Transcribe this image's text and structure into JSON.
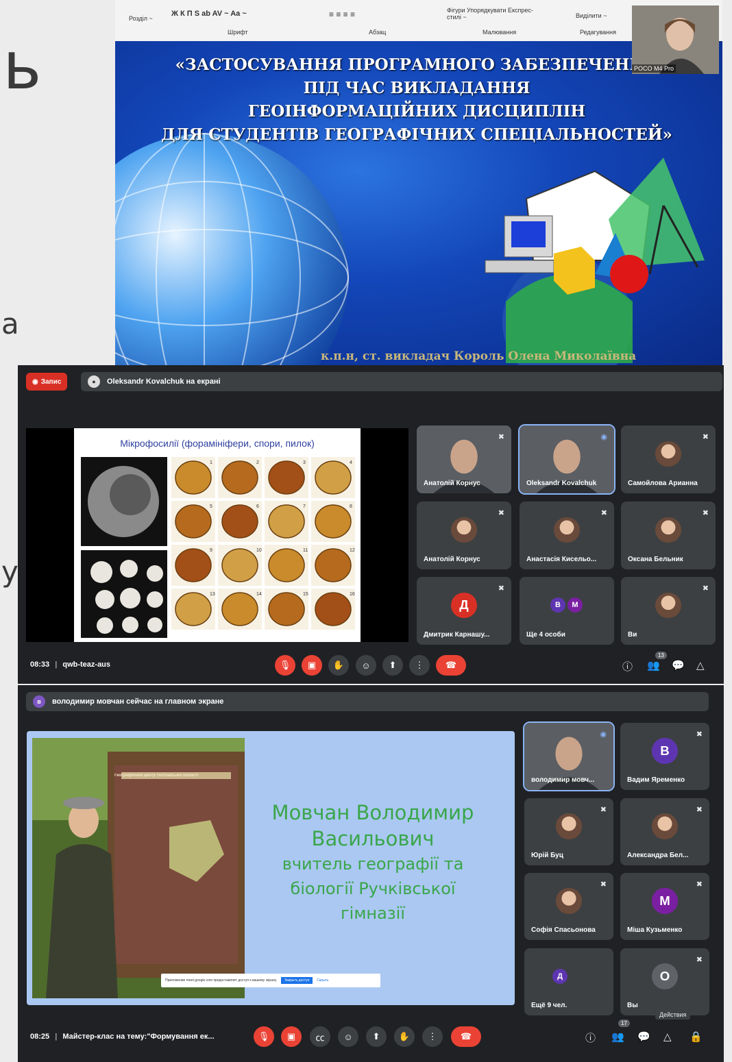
{
  "background": {
    "letters": [
      "ь",
      "а",
      "у"
    ]
  },
  "ppt": {
    "ribbon": {
      "left_items": [
        "Розділ ~"
      ],
      "font_tools": "Ж  К  П  S  ab  AV ~  Aa ~",
      "groups": [
        "Шрифт",
        "Абзац",
        "Малювання",
        "Редагування"
      ],
      "shapes_label": "Фігури Упорядкувати Експрес-стилі ~",
      "select_label": "Виділити ~"
    },
    "camera_label": "POCO M4 Pro",
    "slide": {
      "title_lines": [
        "«ЗАСТОСУВАННЯ ПРОГРАМНОГО ЗАБЕЗПЕЧЕННЯ",
        "ПІД ЧАС ВИКЛАДАННЯ",
        "ГЕОІНФОРМАЦІЙНИХ ДИСЦИПЛІН",
        "ДЛЯ СТУДЕНТІВ ГЕОГРАФІЧНИХ СПЕЦІАЛЬНОСТЕЙ»"
      ],
      "author": "к.п.н, ст. викладач Король Олена Миколаївна"
    }
  },
  "meet1": {
    "record_label": "Запис",
    "presenting_text": "Oleksandr Kovalchuk на екрані",
    "shared_slide_title": "Мікрофосилії (форамініфери, спори, пилок)",
    "pollen_numbers": [
      "1",
      "2",
      "3",
      "4",
      "5",
      "6",
      "7",
      "8",
      "9",
      "10",
      "11",
      "12",
      "13",
      "14",
      "15",
      "16"
    ],
    "participants": [
      {
        "name": "Анатолій Корнус",
        "kind": "video"
      },
      {
        "name": "Oleksandr Kovalchuk",
        "kind": "video"
      },
      {
        "name": "Самойлова Арианна",
        "kind": "photo"
      },
      {
        "name": "Анатолій Корнус",
        "kind": "photo"
      },
      {
        "name": "Анастасія Кисельо...",
        "kind": "photo"
      },
      {
        "name": "Оксана Бельник",
        "kind": "photo"
      },
      {
        "name": "Дмитрик Карнашу...",
        "kind": "letter",
        "letter": "Д"
      },
      {
        "name": "Ще 4 особи",
        "kind": "group",
        "letters": [
          "В",
          "М"
        ]
      },
      {
        "name": "Ви",
        "kind": "photo"
      }
    ],
    "time": "08:33",
    "meeting_code": "qwb-teaz-aus",
    "people_count": "13"
  },
  "meet2": {
    "presenting_avatar": "в",
    "presenting_text": "володимир мовчан сейчас на главном экране",
    "shared_slide_lines": [
      "Мовчан Володимир",
      "Васильович",
      "вчитель географії та",
      "біології Ручківської",
      "гімназії"
    ],
    "sign_title": "Географічний центр Полтавської області",
    "share_notice": "Приложение meet.google.com предоставляет доступ к вашему экрану.",
    "share_stop": "Закрыть доступ",
    "share_hide": "Скрыть",
    "participants": [
      {
        "name": "володимир мовч...",
        "kind": "video"
      },
      {
        "name": "Вадим Яременко",
        "kind": "letter",
        "letter": "В"
      },
      {
        "name": "Юрій Буц",
        "kind": "photo"
      },
      {
        "name": "Александра Бел...",
        "kind": "photo"
      },
      {
        "name": "Софія Спасьонова",
        "kind": "photo"
      },
      {
        "name": "Міша Кузьменко",
        "kind": "letter",
        "letter": "М"
      },
      {
        "name": "Ещё 9 чел.",
        "kind": "group",
        "letters": [
          "Д"
        ]
      },
      {
        "name": "Вы",
        "kind": "letter",
        "letter": "О"
      }
    ],
    "actions_tooltip": "Действия",
    "time": "08:25",
    "meeting_title": "Майстер-клас на тему:\"Формування ек...",
    "people_count": "17"
  },
  "colors": {
    "meet_bg": "#202124",
    "tile_bg": "#3c4043",
    "red": "#ea4335",
    "presenting_blue": "#8ab4f8",
    "slide_green": "#3aa64a"
  }
}
